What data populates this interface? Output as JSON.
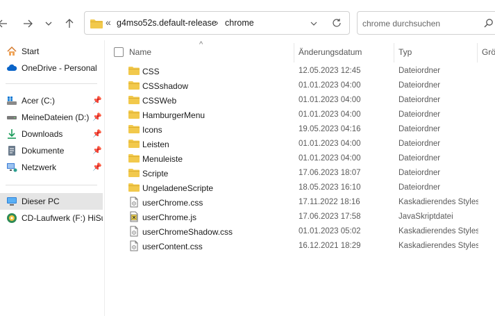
{
  "address": {
    "overflow": "«",
    "crumbs": [
      "g4mso52s.default-release",
      "chrome"
    ]
  },
  "search": {
    "placeholder": "chrome durchsuchen"
  },
  "sidebar": {
    "items": [
      {
        "label": "Start",
        "icon": "home-icon",
        "pinned": false
      },
      {
        "label": "OneDrive - Personal",
        "icon": "cloud-icon",
        "pinned": false
      },
      {
        "label": "Acer (C:)",
        "icon": "drive-windows-icon",
        "pinned": true
      },
      {
        "label": "MeineDateien (D:)",
        "icon": "drive-icon",
        "pinned": true
      },
      {
        "label": "Downloads",
        "icon": "download-icon",
        "pinned": true
      },
      {
        "label": "Dokumente",
        "icon": "document-icon",
        "pinned": true
      },
      {
        "label": "Netzwerk",
        "icon": "network-icon",
        "pinned": true
      },
      {
        "label": "Dieser PC",
        "icon": "pc-icon",
        "pinned": false,
        "selected": true
      },
      {
        "label": "CD-Laufwerk (F:) HiSuite",
        "icon": "cd-drive-icon",
        "pinned": false
      }
    ]
  },
  "columns": {
    "name": "Name",
    "date": "Änderungsdatum",
    "type": "Typ",
    "size": "Größe"
  },
  "files": [
    {
      "name": "CSS",
      "date": "12.05.2023 12:45",
      "type": "Dateiordner",
      "kind": "folder"
    },
    {
      "name": "CSSshadow",
      "date": "01.01.2023 04:00",
      "type": "Dateiordner",
      "kind": "folder"
    },
    {
      "name": "CSSWeb",
      "date": "01.01.2023 04:00",
      "type": "Dateiordner",
      "kind": "folder"
    },
    {
      "name": "HamburgerMenu",
      "date": "01.01.2023 04:00",
      "type": "Dateiordner",
      "kind": "folder"
    },
    {
      "name": "Icons",
      "date": "19.05.2023 04:16",
      "type": "Dateiordner",
      "kind": "folder"
    },
    {
      "name": "Leisten",
      "date": "01.01.2023 04:00",
      "type": "Dateiordner",
      "kind": "folder"
    },
    {
      "name": "Menuleiste",
      "date": "01.01.2023 04:00",
      "type": "Dateiordner",
      "kind": "folder"
    },
    {
      "name": "Scripte",
      "date": "17.06.2023 18:07",
      "type": "Dateiordner",
      "kind": "folder"
    },
    {
      "name": "UngeladeneScripte",
      "date": "18.05.2023 16:10",
      "type": "Dateiordner",
      "kind": "folder"
    },
    {
      "name": "userChrome.css",
      "date": "17.11.2022 18:16",
      "type": "Kaskadierendes Stylesheet",
      "kind": "css"
    },
    {
      "name": "userChrome.js",
      "date": "17.06.2023 17:58",
      "type": "JavaSkriptdatei",
      "kind": "js"
    },
    {
      "name": "userChromeShadow.css",
      "date": "01.01.2023 05:02",
      "type": "Kaskadierendes Stylesheet",
      "kind": "css"
    },
    {
      "name": "userContent.css",
      "date": "16.12.2021 18:29",
      "type": "Kaskadierendes Stylesheet",
      "kind": "css"
    }
  ],
  "colors": {
    "folder": "#f2c94c",
    "folder_dark": "#dcae2e",
    "selected": "#e5e5e5",
    "accent": "#0a64c8"
  }
}
